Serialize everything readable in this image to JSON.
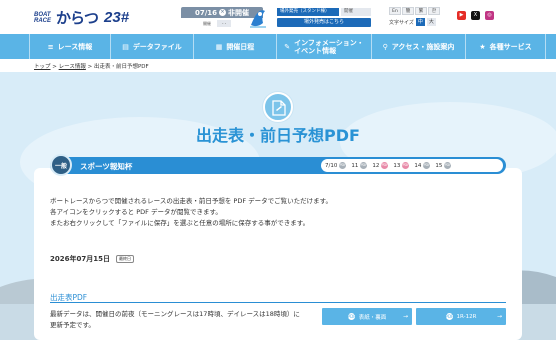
{
  "header": {
    "logo_small_top": "BOAT",
    "logo_small_bottom": "RACE",
    "logo_name": "からつ",
    "logo_number": "23#",
    "schedule": {
      "date": "07/16",
      "status_icon": "×",
      "status": "非開催",
      "row_label": "開催",
      "row_value": "- -"
    },
    "venue": {
      "status_label": "場外発売（スタンド棟）",
      "status_value": "開催",
      "button": "場外発売はこちら"
    },
    "languages": [
      "En",
      "簡",
      "繁",
      "한"
    ],
    "font_size_label": "文字サイズ",
    "font_sizes": [
      "中",
      "大"
    ],
    "sns": [
      {
        "name": "youtube",
        "color": "#e52d27",
        "glyph": "▶"
      },
      {
        "name": "x",
        "color": "#111111",
        "glyph": "X"
      },
      {
        "name": "instagram",
        "color": "#c13584",
        "glyph": "◎"
      }
    ]
  },
  "nav": [
    {
      "label": "レース情報",
      "icon": "≡"
    },
    {
      "label": "データファイル",
      "icon": "▤"
    },
    {
      "label": "開催日程",
      "icon": "▦"
    },
    {
      "label": "インフォメーション・\nイベント情報",
      "icon": "✎"
    },
    {
      "label": "アクセス・施設案内",
      "icon": "⚲"
    },
    {
      "label": "各種サービス",
      "icon": "★"
    }
  ],
  "breadcrumb": {
    "home": "トップ",
    "sep": ">",
    "race": "レース情報",
    "current": "出走表・前日予想PDF"
  },
  "page_title": "出走表・前日予想PDF",
  "race_bar": {
    "grade": "一般",
    "name": "スポーツ報知杯",
    "days": [
      {
        "label": "7/10",
        "color": "grey"
      },
      {
        "label": "11",
        "color": "grey"
      },
      {
        "label": "12",
        "color": "pink"
      },
      {
        "label": "13",
        "color": "pink"
      },
      {
        "label": "14",
        "color": "grey"
      },
      {
        "label": "15",
        "color": "grey"
      }
    ],
    "pdf_mark": "PDF"
  },
  "intro_lines": [
    "ボートレースからつで開催されるレースの出走表・前日予想を PDF データでご覧いただけます。",
    "各アイコンをクリックすると PDF データが閲覧できます。",
    "またお右クリックして「ファイルに保存」を選ぶと任意の場所に保存する事ができます。"
  ],
  "date_section": {
    "date": "2026年07月15日",
    "tag": "最終日"
  },
  "section_title": "出走表PDF",
  "note_lines": [
    "最新データは、開催日の前夜（モーニングレースは17時頃、デイレースは18時頃）に",
    "更新予定です。"
  ],
  "buttons": [
    {
      "label": "表紙・裏面",
      "icon": "PDF"
    },
    {
      "label": "1R-12R",
      "icon": "PDF"
    }
  ]
}
